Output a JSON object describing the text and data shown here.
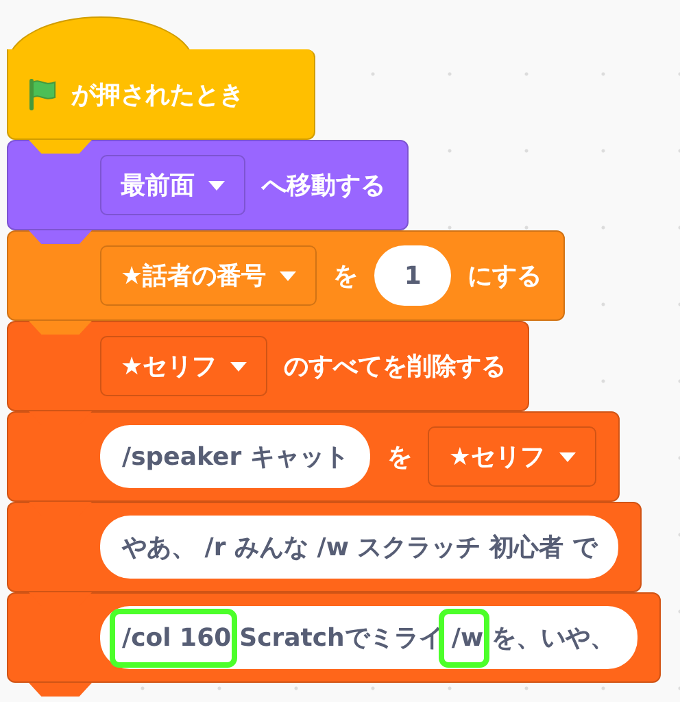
{
  "blocks": [
    {
      "kind": "hat",
      "color": "#ffbf00",
      "parts": [
        {
          "kind": "flag"
        },
        {
          "kind": "label",
          "text": "が押されたとき"
        }
      ]
    },
    {
      "kind": "stack",
      "color": "#9966ff",
      "parts": [
        {
          "kind": "dropdown",
          "text": "最前面"
        },
        {
          "kind": "label",
          "text": "へ移動する"
        }
      ]
    },
    {
      "kind": "stack",
      "color": "#ff8c1a",
      "parts": [
        {
          "kind": "dropdown",
          "text": "★話者の番号"
        },
        {
          "kind": "label",
          "text": "を"
        },
        {
          "kind": "number",
          "text": "1"
        },
        {
          "kind": "label",
          "text": "にする"
        }
      ]
    },
    {
      "kind": "stack",
      "color": "#ff661a",
      "parts": [
        {
          "kind": "dropdown",
          "text": "★セリフ"
        },
        {
          "kind": "label",
          "text": "のすべてを削除する"
        }
      ]
    },
    {
      "kind": "stack",
      "color": "#ff661a",
      "parts": [
        {
          "kind": "string",
          "segments": [
            {
              "text": "/speaker キャット",
              "highlighted": false
            }
          ]
        },
        {
          "kind": "label",
          "text": "を"
        },
        {
          "kind": "dropdown",
          "text": "★セリフ"
        }
      ]
    },
    {
      "kind": "stack",
      "color": "#ff661a",
      "parts": [
        {
          "kind": "string",
          "segments": [
            {
              "text": "やあ、 /r みんな /w スクラッチ 初心者 で",
              "highlighted": false
            }
          ]
        }
      ]
    },
    {
      "kind": "stack",
      "color": "#ff661a",
      "parts": [
        {
          "kind": "string",
          "segments": [
            {
              "text": "/col 160",
              "highlighted": true
            },
            {
              "text": "Scratchでミライ",
              "highlighted": false
            },
            {
              "text": "/w",
              "highlighted": true
            },
            {
              "text": "を、いや、",
              "highlighted": false
            }
          ]
        }
      ]
    }
  ]
}
